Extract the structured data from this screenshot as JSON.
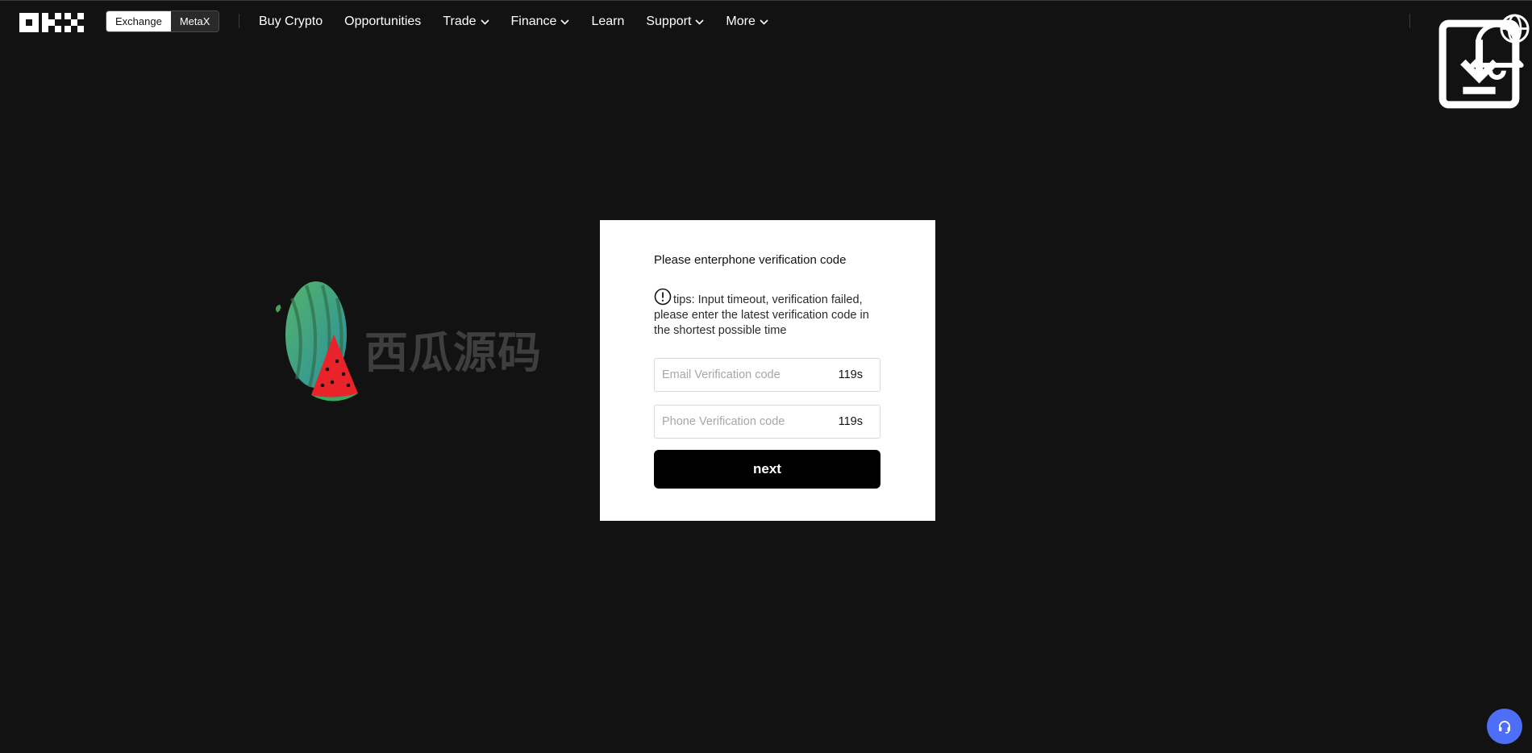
{
  "header": {
    "logo_icon": "okx-logo",
    "mode_toggle": {
      "options": [
        "Exchange",
        "MetaX"
      ],
      "selected": "Exchange"
    },
    "nav": [
      {
        "label": "Buy Crypto",
        "dropdown": false
      },
      {
        "label": "Opportunities",
        "dropdown": false
      },
      {
        "label": "Trade",
        "dropdown": true
      },
      {
        "label": "Finance",
        "dropdown": true
      },
      {
        "label": "Learn",
        "dropdown": false
      },
      {
        "label": "Support",
        "dropdown": true
      },
      {
        "label": "More",
        "dropdown": true
      }
    ],
    "right_icons": [
      "download-icon",
      "bell-icon",
      "globe-icon"
    ]
  },
  "watermark": {
    "text": "西瓜源码",
    "icon": "watermelon-logo"
  },
  "modal": {
    "title": "Please enterphone verification code",
    "tips_icon": "alert-circle-icon",
    "tips_text": "tips: Input timeout, verification failed, please enter the latest verification code in the shortest possible time",
    "email_field": {
      "placeholder": "Email Verification code",
      "value": "",
      "timer": "119s"
    },
    "phone_field": {
      "placeholder": "Phone Verification code",
      "value": "",
      "timer": "119s"
    },
    "next_label": "next"
  },
  "support_button_icon": "headset-icon",
  "colors": {
    "background": "#121212",
    "modal_bg": "#ffffff",
    "button_bg": "#000000",
    "support_fab": "#4d6ef7"
  }
}
